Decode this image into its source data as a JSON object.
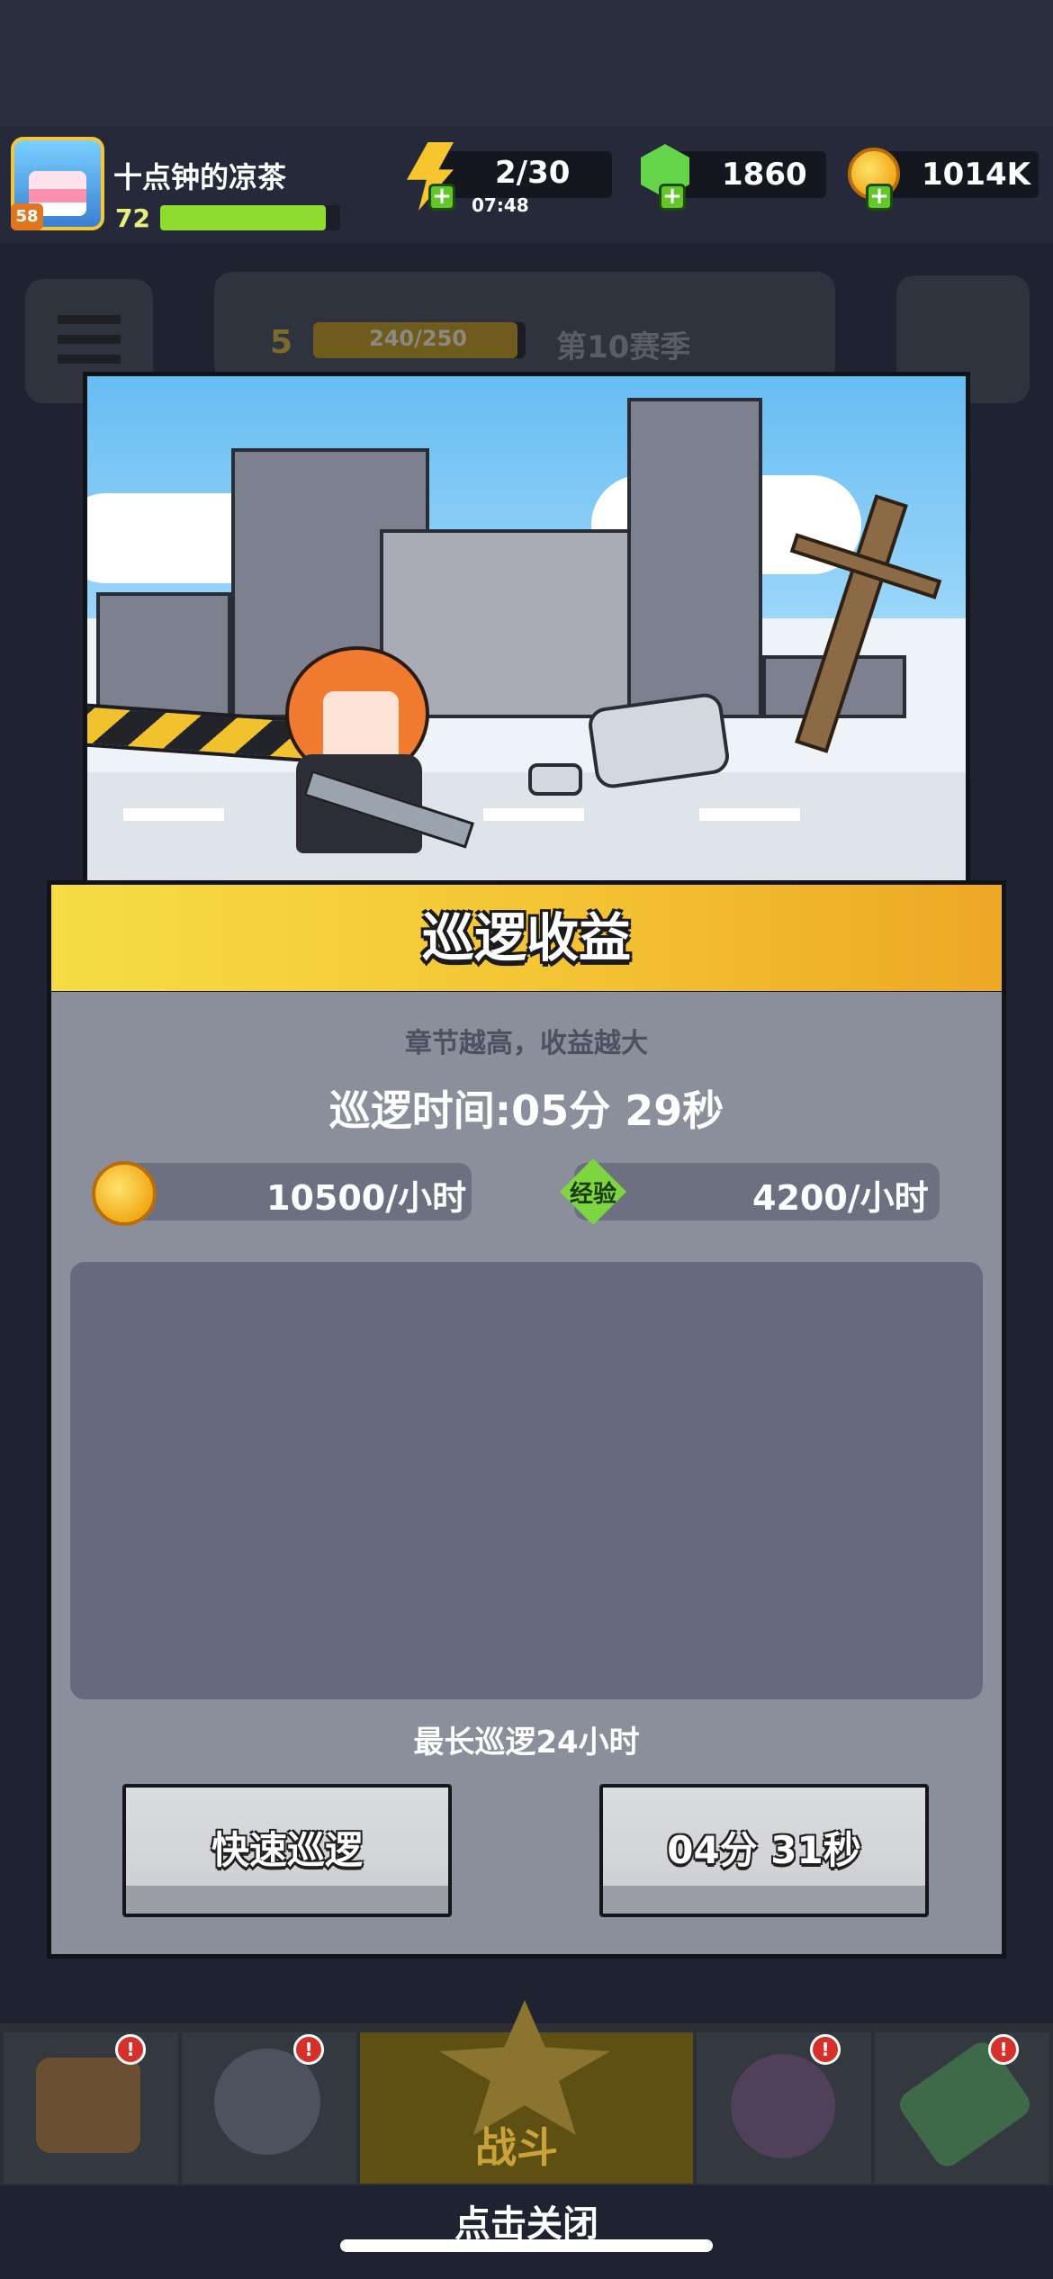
{
  "hud": {
    "player_name": "十点钟的凉茶",
    "player_level": "72",
    "avatar_level": "58",
    "xp_fraction": 0.92,
    "energy": "2/30",
    "energy_timer": "07:48",
    "gems": "1860",
    "gold": "1014K"
  },
  "background": {
    "season_level": "5",
    "season_progress": "240/250",
    "season_label": "第10赛季",
    "battle_label": "战斗"
  },
  "modal": {
    "title": "巡逻收益",
    "subtitle": "章节越高，收益越大",
    "patrol_time": "巡逻时间:05分 29秒",
    "gold_rate": "10500/小时",
    "exp_label": "经验",
    "exp_rate": "4200/小时",
    "max_patrol": "最长巡逻24小时",
    "quick_patrol_button": "快速巡逻",
    "claim_timer_button": "04分 31秒"
  },
  "close_hint": "点击关闭",
  "icons": [
    "energy-icon",
    "gem-icon",
    "gold-coin-icon",
    "exp-icon",
    "menu-icon",
    "shop-icon",
    "equipment-icon",
    "battle-icon",
    "talent-icon",
    "evolution-icon"
  ],
  "colors": {
    "banner": "#f4c334",
    "panel": "#8b8f9b",
    "reward_area": "#666a7f",
    "button": "#cfd1d5"
  }
}
